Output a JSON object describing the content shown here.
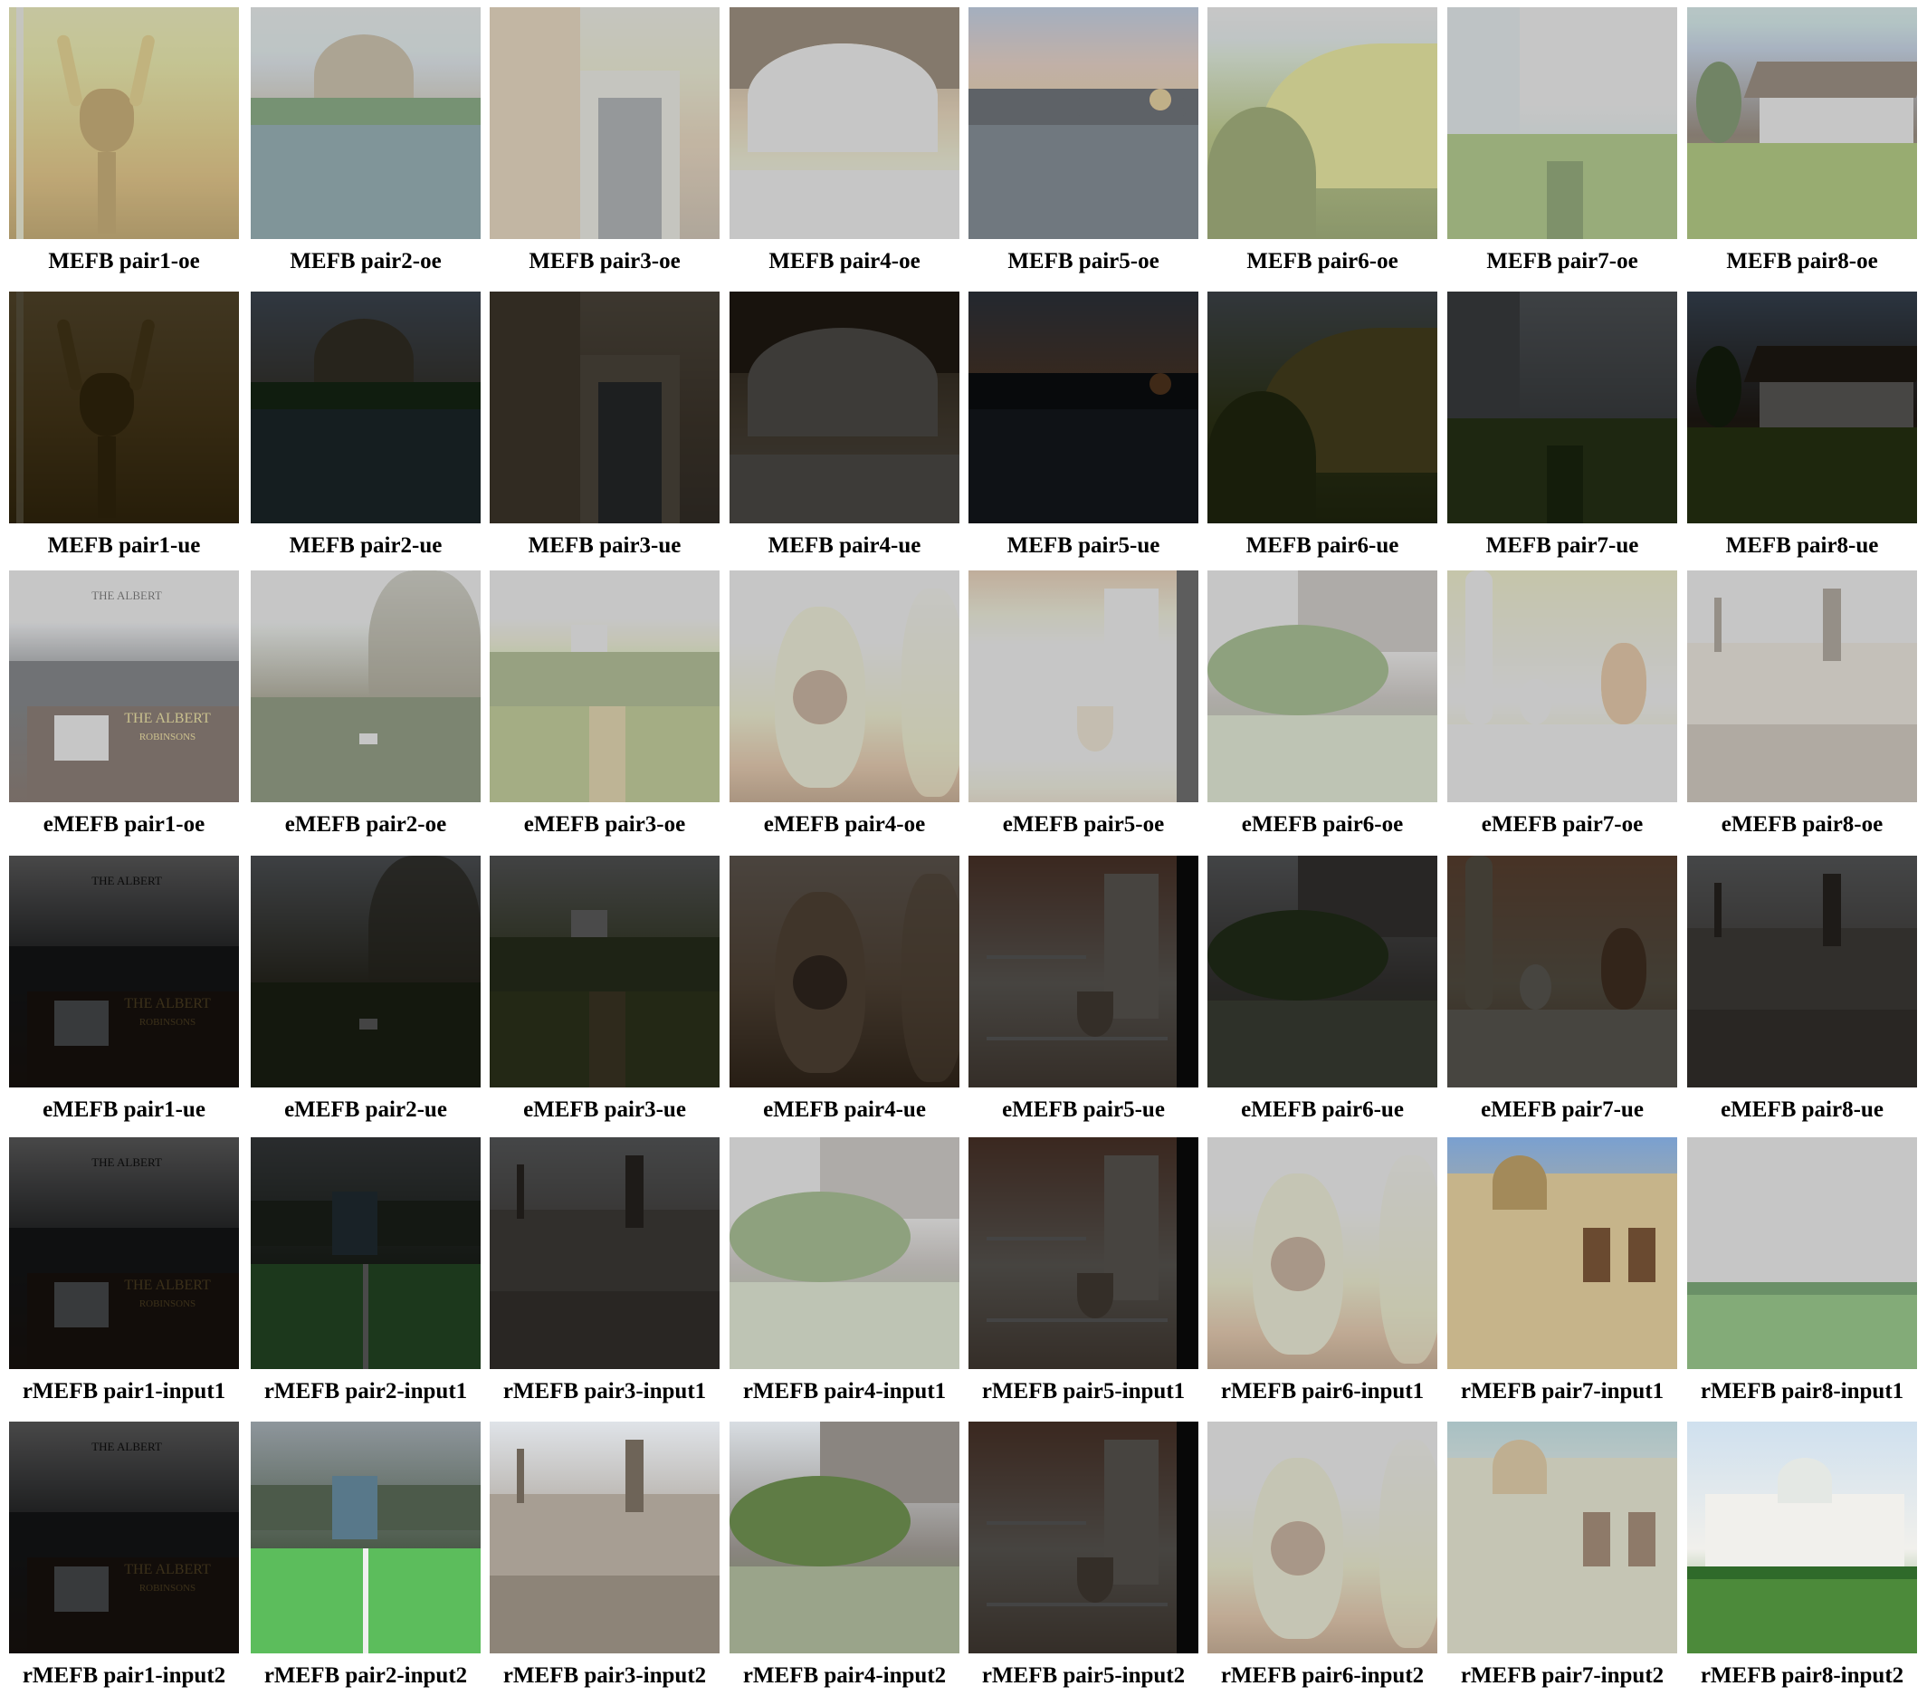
{
  "rows": [
    {
      "id": "mefb-oe",
      "captions": [
        "MEFB pair1-oe",
        "MEFB pair2-oe",
        "MEFB pair3-oe",
        "MEFB pair4-oe",
        "MEFB pair5-oe",
        "MEFB pair6-oe",
        "MEFB pair7-oe",
        "MEFB pair8-oe"
      ],
      "subjects": [
        "bull-head-sculpture",
        "palace-rotunda-lake",
        "stone-doorway",
        "stone-arcade",
        "river-bridge-sunset",
        "hillside-shrubs",
        "tower-park",
        "timber-house-field"
      ],
      "exposure": "over"
    },
    {
      "id": "mefb-ue",
      "captions": [
        "MEFB pair1-ue",
        "MEFB pair2-ue",
        "MEFB pair3-ue",
        "MEFB pair4-ue",
        "MEFB pair5-ue",
        "MEFB pair6-ue",
        "MEFB pair7-ue",
        "MEFB pair8-ue"
      ],
      "subjects": [
        "bull-head-sculpture",
        "palace-rotunda-lake",
        "stone-doorway",
        "stone-arcade",
        "river-bridge-sunset",
        "hillside-shrubs",
        "tower-park",
        "timber-house-field"
      ],
      "exposure": "under"
    },
    {
      "id": "emefb-oe",
      "captions": [
        "eMEFB pair1-oe",
        "eMEFB pair2-oe",
        "eMEFB pair3-oe",
        "eMEFB pair4-oe",
        "eMEFB pair5-oe",
        "eMEFB pair6-oe",
        "eMEFB pair7-oe",
        "eMEFB pair8-oe"
      ],
      "subjects": [
        "pub-facade",
        "garden-trees",
        "countryside-path",
        "painted-vase",
        "museum-showcase",
        "castle-garden",
        "pottery-display",
        "city-skyline"
      ],
      "exposure": "over"
    },
    {
      "id": "emefb-ue",
      "captions": [
        "eMEFB pair1-ue",
        "eMEFB pair2-ue",
        "eMEFB pair3-ue",
        "eMEFB pair4-ue",
        "eMEFB pair5-ue",
        "eMEFB pair6-ue",
        "eMEFB pair7-ue",
        "eMEFB pair8-ue"
      ],
      "subjects": [
        "pub-facade",
        "garden-trees",
        "countryside-path",
        "painted-vase",
        "museum-showcase",
        "castle-garden",
        "pottery-display",
        "city-skyline"
      ],
      "exposure": "under"
    },
    {
      "id": "rmefb-input1",
      "captions": [
        "rMEFB pair1-input1",
        "rMEFB pair2-input1",
        "rMEFB pair3-input1",
        "rMEFB pair4-input1",
        "rMEFB pair5-input1",
        "rMEFB pair6-input1",
        "rMEFB pair7-input1",
        "rMEFB pair8-input1"
      ],
      "subjects": [
        "pub-facade",
        "ev-parking",
        "city-skyline",
        "castle-garden",
        "museum-showcase",
        "painted-vase",
        "ornate-palace",
        "white-palace"
      ],
      "exposure": [
        "under",
        "under",
        "under",
        "over",
        "under",
        "over",
        "normal",
        "over"
      ]
    },
    {
      "id": "rmefb-input2",
      "captions": [
        "rMEFB pair1-input2",
        "rMEFB pair2-input2",
        "rMEFB pair3-input2",
        "rMEFB pair4-input2",
        "rMEFB pair5-input2",
        "rMEFB pair6-input2",
        "rMEFB pair7-input2",
        "rMEFB pair8-input2"
      ],
      "subjects": [
        "pub-facade",
        "ev-parking",
        "city-skyline",
        "castle-garden",
        "museum-showcase",
        "painted-vase",
        "ornate-palace",
        "white-palace"
      ],
      "exposure": [
        "under",
        "normal",
        "normal",
        "normal",
        "under",
        "over",
        "over",
        "normal"
      ]
    }
  ],
  "sign_texts": {
    "pub_name": "THE ALBERT",
    "pub_sub": "ROBINSONS"
  }
}
